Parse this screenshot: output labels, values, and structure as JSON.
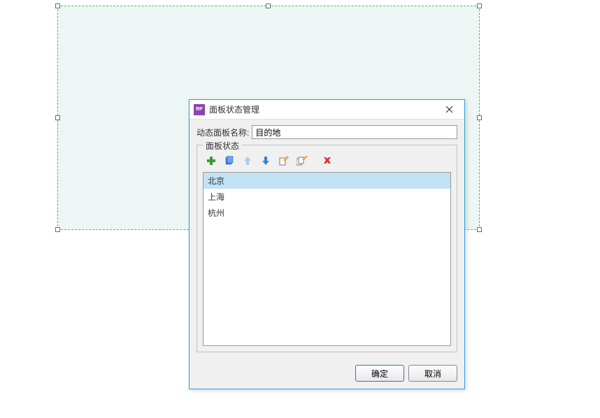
{
  "dialog": {
    "title": "面板状态管理",
    "app_icon_text": "RP",
    "name_label": "动态面板名称:",
    "name_value": "目的地",
    "fieldset_legend": "面板状态",
    "states": [
      {
        "label": "北京",
        "selected": true
      },
      {
        "label": "上海",
        "selected": false
      },
      {
        "label": "杭州",
        "selected": false
      }
    ],
    "buttons": {
      "ok": "确定",
      "cancel": "取消"
    }
  }
}
